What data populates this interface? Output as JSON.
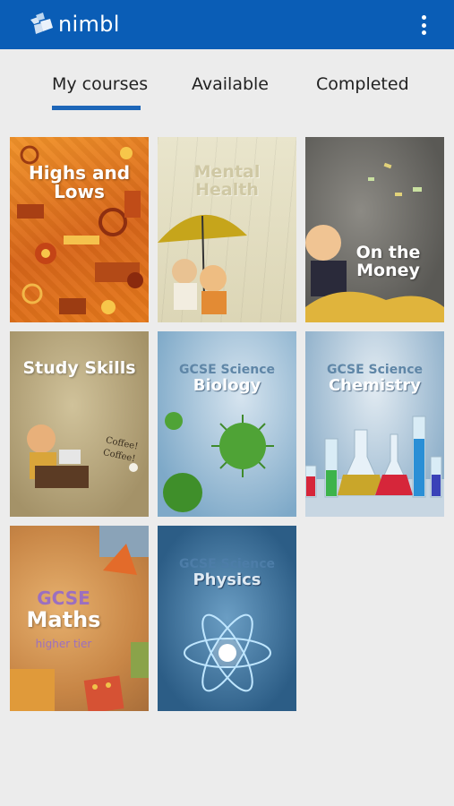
{
  "app": {
    "brand": "nimbl"
  },
  "tabs": [
    {
      "label": "My courses",
      "active": true
    },
    {
      "label": "Available",
      "active": false
    },
    {
      "label": "Completed",
      "active": false
    }
  ],
  "courses": [
    {
      "line1": "Highs and",
      "line2": "Lows"
    },
    {
      "line1": "Mental",
      "line2": "Health"
    },
    {
      "line1": "On the",
      "line2": "Money"
    },
    {
      "line1": "Study Skills",
      "coffee": "Coffee! Coffee!"
    },
    {
      "line1": "GCSE Science",
      "line2": "Biology"
    },
    {
      "line1": "GCSE Science",
      "line2": "Chemistry"
    },
    {
      "line1": "GCSE",
      "line2": "Maths",
      "line3": "higher tier"
    },
    {
      "line1": "GCSE Science",
      "line2": "Physics"
    }
  ],
  "colors": {
    "appbar": "#0a5db6",
    "tab_indicator": "#1d66b8",
    "background": "#ececec"
  }
}
